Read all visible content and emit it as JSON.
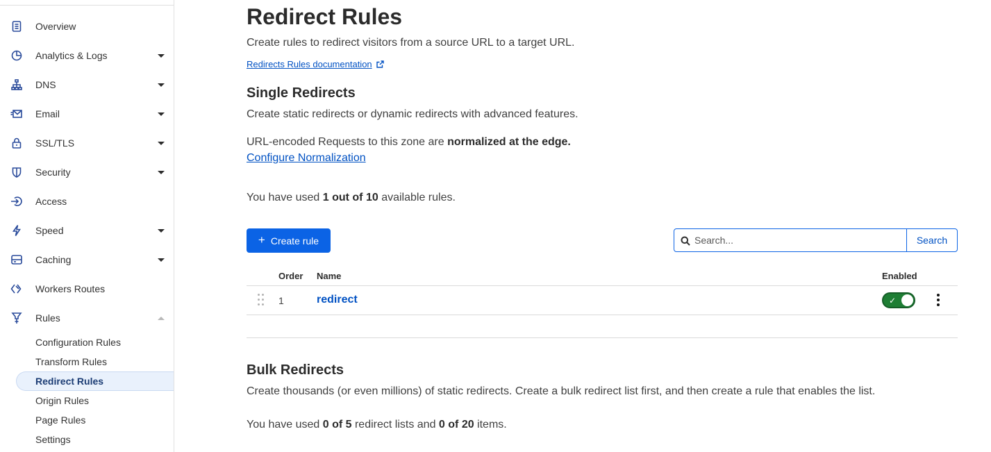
{
  "sidebar": {
    "items": [
      {
        "label": "Overview",
        "icon": "document-icon",
        "caret": "none"
      },
      {
        "label": "Analytics & Logs",
        "icon": "pie-chart-icon",
        "caret": "down"
      },
      {
        "label": "DNS",
        "icon": "network-icon",
        "caret": "down"
      },
      {
        "label": "Email",
        "icon": "email-icon",
        "caret": "down"
      },
      {
        "label": "SSL/TLS",
        "icon": "lock-icon",
        "caret": "down"
      },
      {
        "label": "Security",
        "icon": "shield-icon",
        "caret": "down"
      },
      {
        "label": "Access",
        "icon": "access-icon",
        "caret": "none"
      },
      {
        "label": "Speed",
        "icon": "lightning-icon",
        "caret": "down"
      },
      {
        "label": "Caching",
        "icon": "storage-icon",
        "caret": "down"
      },
      {
        "label": "Workers Routes",
        "icon": "workers-icon",
        "caret": "none"
      },
      {
        "label": "Rules",
        "icon": "rules-icon",
        "caret": "up"
      }
    ],
    "subitems": [
      {
        "label": "Configuration Rules"
      },
      {
        "label": "Transform Rules"
      },
      {
        "label": "Redirect Rules",
        "active": true
      },
      {
        "label": "Origin Rules"
      },
      {
        "label": "Page Rules"
      },
      {
        "label": "Settings"
      }
    ]
  },
  "main": {
    "title": "Redirect Rules",
    "description": "Create rules to redirect visitors from a source URL to a target URL.",
    "doc_link": "Redirects Rules documentation",
    "single": {
      "heading": "Single Redirects",
      "description": "Create static redirects or dynamic redirects with advanced features.",
      "normalization_prefix": "URL-encoded Requests to this zone are ",
      "normalization_bold": "normalized at the edge.",
      "configure_link": "Configure Normalization",
      "usage_prefix": "You have used ",
      "usage_bold": "1 out of 10",
      "usage_suffix": " available rules.",
      "create_button": "Create rule",
      "search_placeholder": "Search...",
      "search_button": "Search",
      "table": {
        "headers": {
          "order": "Order",
          "name": "Name",
          "enabled": "Enabled"
        },
        "rows": [
          {
            "order": "1",
            "name": "redirect",
            "enabled": true
          }
        ]
      }
    },
    "bulk": {
      "heading": "Bulk Redirects",
      "description": "Create thousands (or even millions) of static redirects. Create a bulk redirect list first, and then create a rule that enables the list.",
      "usage_prefix": "You have used ",
      "usage_bold1": "0 of 5",
      "usage_mid": " redirect lists and ",
      "usage_bold2": "0 of 20",
      "usage_suffix": " items."
    }
  },
  "colors": {
    "accent": "#0b63e5",
    "link": "#0051c3",
    "toggle_on": "#1e7e34",
    "active_nav_bg": "#e9f1fc"
  }
}
